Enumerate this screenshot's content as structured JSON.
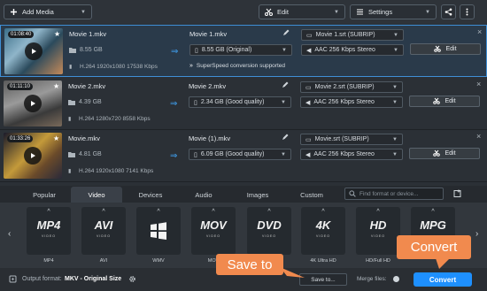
{
  "toolbar": {
    "add_media": "Add Media",
    "edit": "Edit",
    "settings": "Settings"
  },
  "files": [
    {
      "timecode": "01:08:40",
      "source_name": "Movie 1.mkv",
      "source_size": "8.55 GB",
      "source_info": "H.264 1920x1080 17538 Kbps",
      "output_name": "Movie 1.mkv",
      "output_size": "8.55 GB (Original)",
      "subtitle": "Movie 1.srt (SUBRIP)",
      "audio": "AAC 256 Kbps Stereo",
      "note": "SuperSpeed conversion supported",
      "edit_label": "Edit",
      "selected": true
    },
    {
      "timecode": "01:11:10",
      "source_name": "Movie 2.mkv",
      "source_size": "4.39 GB",
      "source_info": "H.264 1280x720 8558 Kbps",
      "output_name": "Movie 2.mkv",
      "output_size": "2.34 GB (Good quality)",
      "subtitle": "Movie 2.srt (SUBRIP)",
      "audio": "AAC 256 Kbps Stereo",
      "note": "",
      "edit_label": "Edit",
      "selected": false
    },
    {
      "timecode": "01:33:26",
      "source_name": "Movie.mkv",
      "source_size": "4.81 GB",
      "source_info": "H.264 1920x1080 7141 Kbps",
      "output_name": "Movie (1).mkv",
      "output_size": "6.09 GB (Good quality)",
      "subtitle": "Movie.srt (SUBRIP)",
      "audio": "AAC 256 Kbps Stereo",
      "note": "",
      "edit_label": "Edit",
      "selected": false
    }
  ],
  "tabs": [
    "Popular",
    "Video",
    "Devices",
    "Audio",
    "Images",
    "Custom"
  ],
  "active_tab": "Video",
  "search_placeholder": "Find format or device...",
  "presets": [
    {
      "logo": "MP4",
      "sub": "VIDEO",
      "label": "MP4"
    },
    {
      "logo": "AVI",
      "sub": "VIDEO",
      "label": "AVI"
    },
    {
      "logo": "",
      "sub": "",
      "label": "WMV"
    },
    {
      "logo": "MOV",
      "sub": "VIDEO",
      "label": "MOV"
    },
    {
      "logo": "DVD",
      "sub": "VIDEO",
      "label": ""
    },
    {
      "logo": "4K",
      "sub": "VIDEO",
      "label": "4K Ultra HD"
    },
    {
      "logo": "HD",
      "sub": "VIDEO",
      "label": "HD/Full HD"
    },
    {
      "logo": "MPG",
      "sub": "",
      "label": ""
    }
  ],
  "bottom": {
    "output_format_label": "Output format:",
    "output_format_value": "MKV - Original Size",
    "save_to": "Save to...",
    "merge_files": "Merge files:",
    "convert": "Convert"
  },
  "callouts": {
    "save_to": "Save to",
    "convert": "Convert"
  },
  "colors": {
    "accent": "#3fa0f0",
    "callout": "#f18a4e",
    "convert_button": "#1e90ff"
  }
}
